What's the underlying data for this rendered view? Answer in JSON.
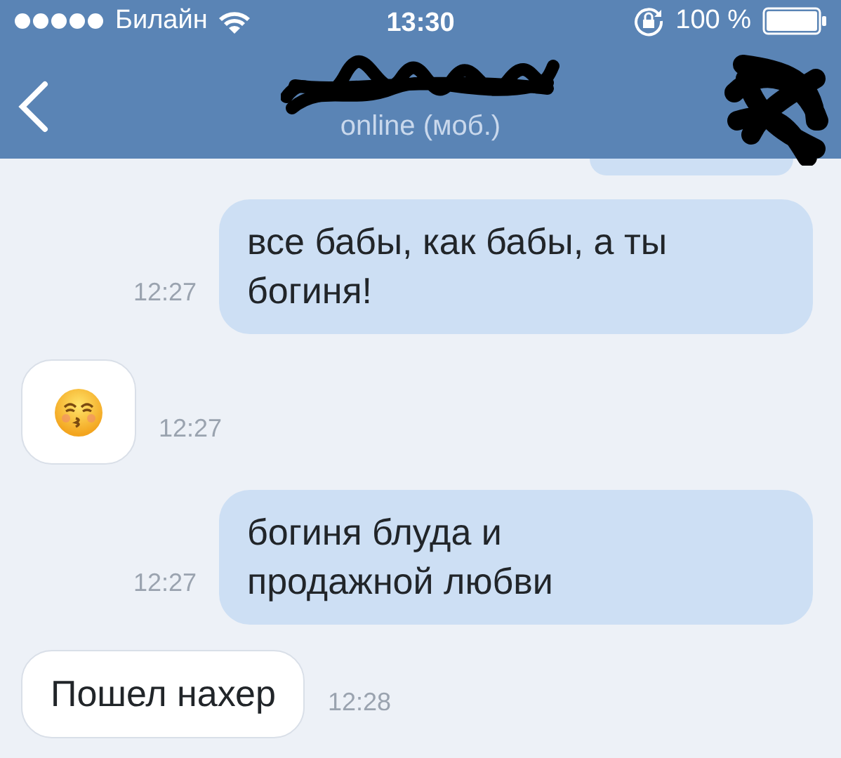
{
  "status_bar": {
    "carrier": "Билайн",
    "time": "13:30",
    "battery": "100 %"
  },
  "header": {
    "status": "online (моб.)"
  },
  "messages": [
    {
      "outgoing": true,
      "kind": "text",
      "text": "все бабы, как бабы, а ты богиня!",
      "time": "12:27"
    },
    {
      "outgoing": false,
      "kind": "emoji",
      "time": "12:27"
    },
    {
      "outgoing": true,
      "kind": "text",
      "text": "богиня блуда и продажной любви",
      "time": "12:27"
    },
    {
      "outgoing": false,
      "kind": "text",
      "text": "Пошел нахер",
      "time": "12:28"
    }
  ]
}
